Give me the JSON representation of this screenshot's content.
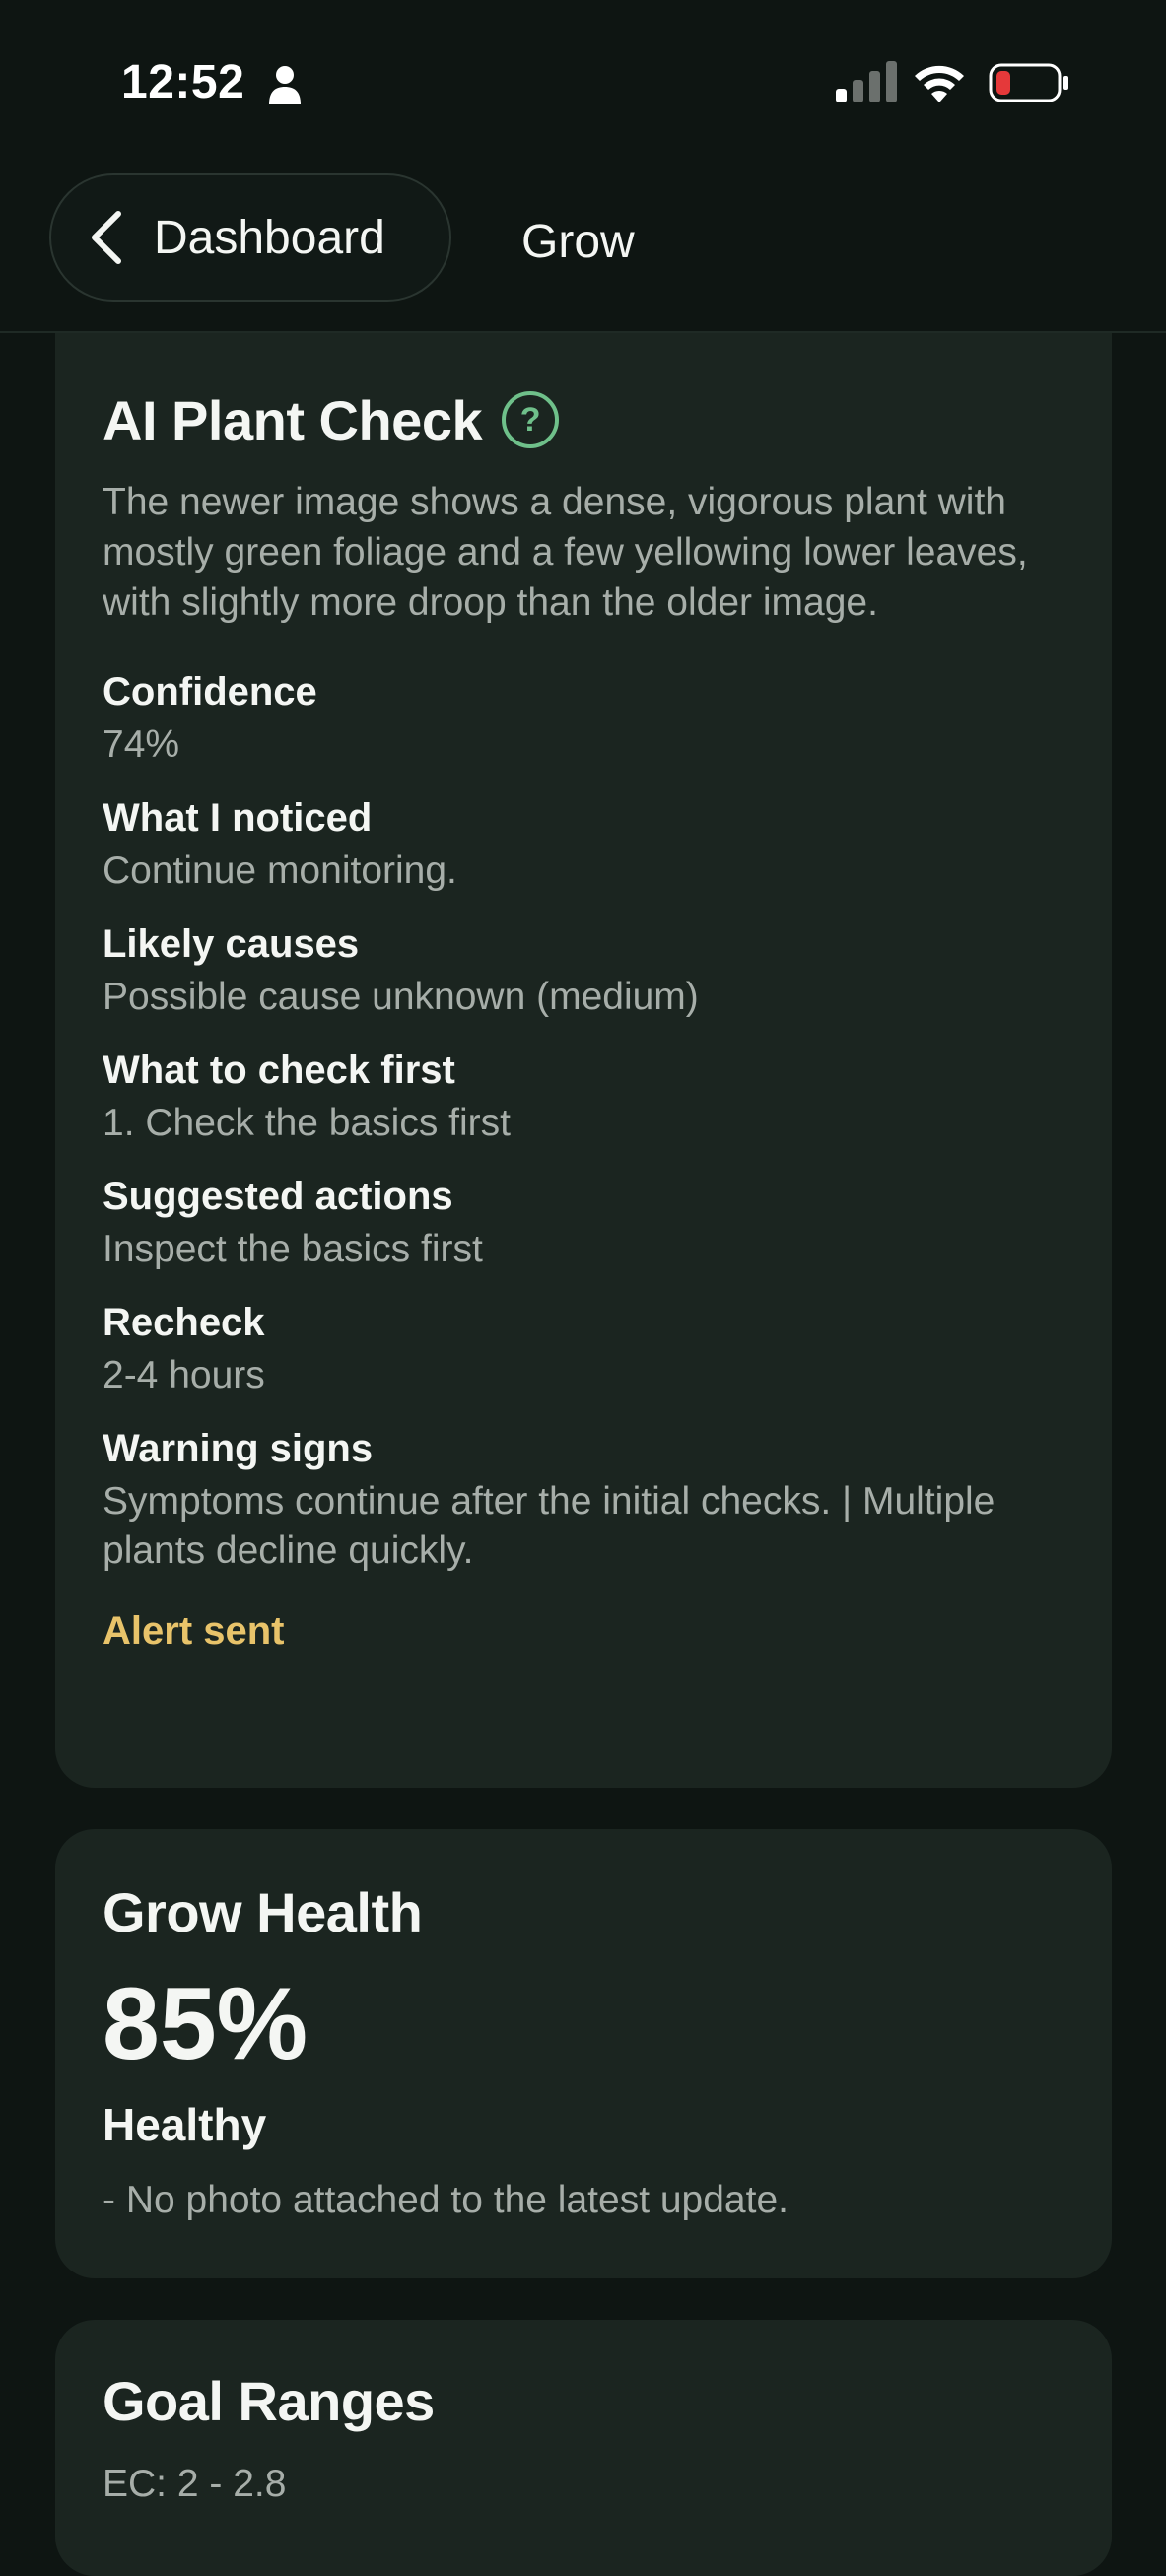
{
  "status_bar": {
    "time": "12:52",
    "icons": [
      "person-icon",
      "signal-icon",
      "wifi-icon",
      "battery-icon"
    ],
    "battery_color": "#e5393a"
  },
  "nav": {
    "back_label": "Dashboard",
    "title": "Grow"
  },
  "plant_check": {
    "title": "AI Plant Check",
    "help_glyph": "?",
    "summary": "The newer image shows a dense, vigorous plant with mostly green foliage and a few yellowing lower leaves, with slightly more droop than the older image.",
    "sections": [
      {
        "label": "Confidence",
        "value": "74%"
      },
      {
        "label": "What I noticed",
        "value": "Continue monitoring."
      },
      {
        "label": "Likely causes",
        "value": "Possible cause unknown (medium)"
      },
      {
        "label": "What to check first",
        "value": "1. Check the basics first"
      },
      {
        "label": "Suggested actions",
        "value": "Inspect the basics first"
      },
      {
        "label": "Recheck",
        "value": "2-4 hours"
      },
      {
        "label": "Warning signs",
        "value": "Symptoms continue after the initial checks. | Multiple plants decline quickly."
      }
    ],
    "alert": "Alert sent"
  },
  "grow_health": {
    "title": "Grow Health",
    "percent": "85%",
    "status": "Healthy",
    "note": "- No photo attached to the latest update."
  },
  "goal_ranges": {
    "title": "Goal Ranges",
    "ec": "EC: 2 - 2.8"
  },
  "colors": {
    "background": "#0e1512",
    "card": "#1b2520",
    "accent_green": "#6fc08a",
    "alert_yellow": "#e8c36a",
    "muted_text": "#a7aea9"
  }
}
